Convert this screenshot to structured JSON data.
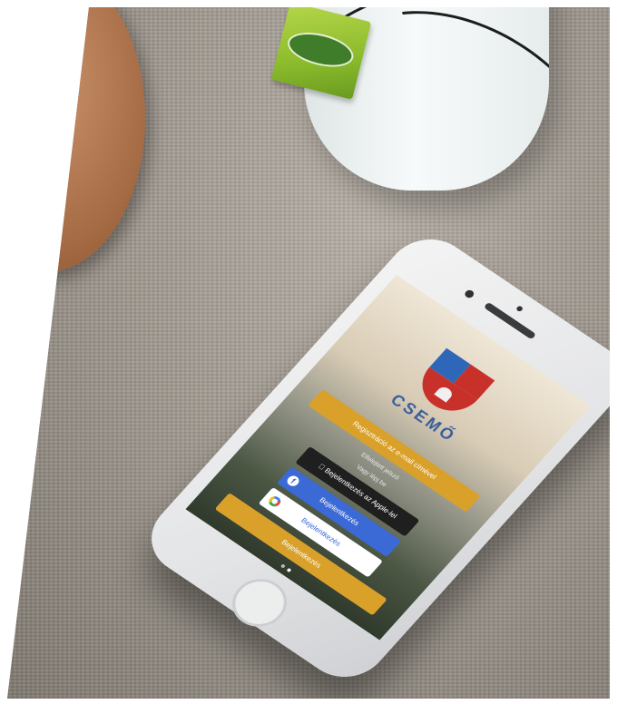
{
  "scene": {
    "brand_name": "CSEMŐ",
    "brand_subtitle": "",
    "buttons": {
      "register_email": "Regisztráció az e-mail címével",
      "forgot_password": "Elfelejtett jelszó",
      "or_text": "Vagy lépj be",
      "apple_login": "Bejelentkezés az Apple-lel",
      "facebook_login": "Bejelentkezés",
      "google_login": "Bejelentkezés",
      "main_login": "Bejelentkezés"
    },
    "icons": [
      "teabag-tag-icon",
      "coat-of-arms-icon",
      "apple-icon",
      "facebook-icon",
      "google-icon"
    ],
    "colors": {
      "accent_gold": "#d9a02a",
      "facebook_blue": "#3b69d6",
      "brand_blue": "#3b5f9a",
      "shield_red": "#c8302a"
    }
  }
}
